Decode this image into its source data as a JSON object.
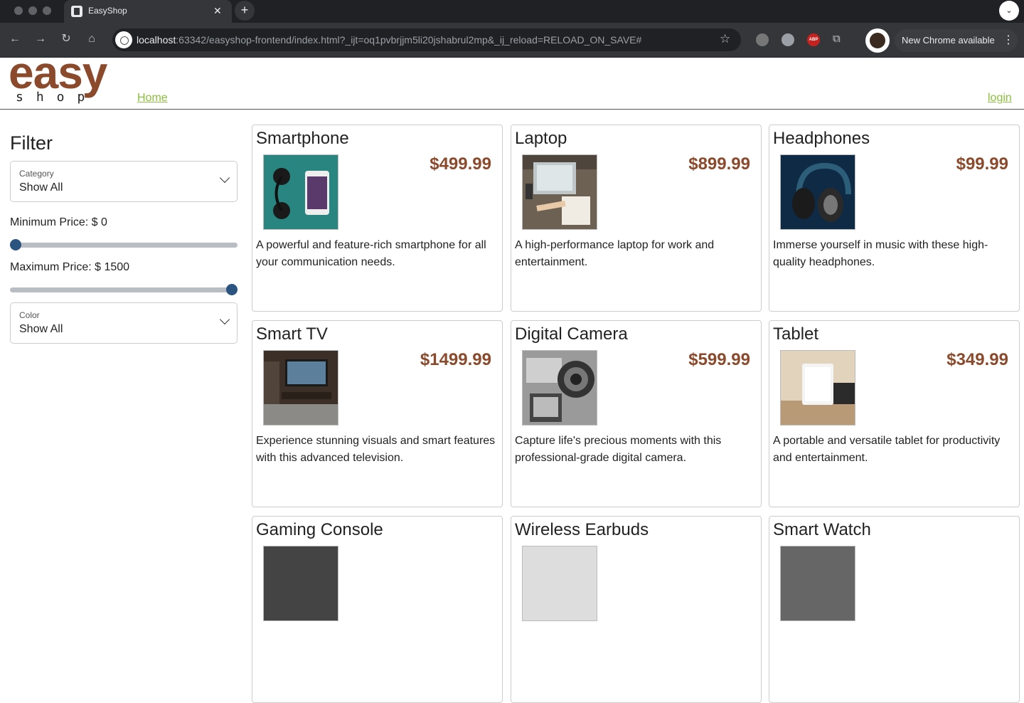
{
  "browser": {
    "tab_title": "EasyShop",
    "url_host": "localhost",
    "url_rest": ":63342/easyshop-frontend/index.html?_ijt=oq1pvbrjjm5li20jshabrul2mp&_ij_reload=RELOAD_ON_SAVE#",
    "update_label": "New Chrome available",
    "extensions": [
      "owl-extension-icon",
      "clock-extension-icon",
      "adblock-plus-icon",
      "puzzle-icon"
    ],
    "abp_label": "ABP"
  },
  "header": {
    "logo_top": "easy",
    "logo_bottom": "shop",
    "nav_home": "Home",
    "nav_login": "login"
  },
  "filter": {
    "title": "Filter",
    "category": {
      "label": "Category",
      "value": "Show All"
    },
    "min_price": {
      "label": "Minimum Price: $ 0",
      "value": 0,
      "max": 1500
    },
    "max_price": {
      "label": "Maximum Price: $ 1500",
      "value": 1500,
      "max": 1500
    },
    "color": {
      "label": "Color",
      "value": "Show All"
    }
  },
  "products": [
    {
      "name": "Smartphone",
      "price": "$499.99",
      "description": "A powerful and feature-rich smartphone for all your communication needs.",
      "image": "smartphone-photo"
    },
    {
      "name": "Laptop",
      "price": "$899.99",
      "description": "A high-performance laptop for work and entertainment.",
      "image": "laptop-photo"
    },
    {
      "name": "Headphones",
      "price": "$99.99",
      "description": "Immerse yourself in music with these high-quality headphones.",
      "image": "headphones-photo"
    },
    {
      "name": "Smart TV",
      "price": "$1499.99",
      "description": "Experience stunning visuals and smart features with this advanced television.",
      "image": "smart-tv-photo"
    },
    {
      "name": "Digital Camera",
      "price": "$599.99",
      "description": "Capture life's precious moments with this professional-grade digital camera.",
      "image": "camera-photo"
    },
    {
      "name": "Tablet",
      "price": "$349.99",
      "description": "A portable and versatile tablet for productivity and entertainment.",
      "image": "tablet-photo"
    },
    {
      "name": "Gaming Console",
      "price": "",
      "description": "",
      "image": "gaming-console-photo"
    },
    {
      "name": "Wireless Earbuds",
      "price": "",
      "description": "",
      "image": "earbuds-photo"
    },
    {
      "name": "Smart Watch",
      "price": "",
      "description": "",
      "image": "smart-watch-photo"
    }
  ],
  "colors": {
    "brand": "#8b4a2b",
    "link": "#8bbf3f",
    "slider_thumb": "#2b5580"
  }
}
